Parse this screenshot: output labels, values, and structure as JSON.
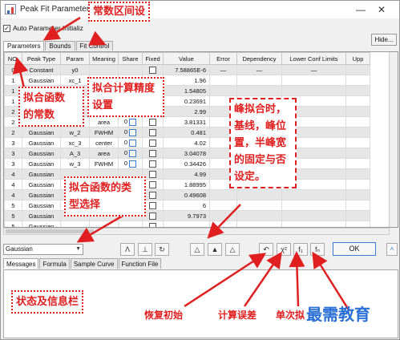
{
  "window": {
    "title": "Peak Fit Parameters"
  },
  "auto_param": {
    "label": "Auto Parameter Initializ"
  },
  "hide_button": "Hide...",
  "tabs": [
    {
      "label": "Parameters"
    },
    {
      "label": "Bounds"
    },
    {
      "label": "Fit Control"
    }
  ],
  "columns": [
    "NO.",
    "Peak Type",
    "Param",
    "Meaning",
    "Share",
    "Fixed",
    "Value",
    "Error",
    "Dependency",
    "Lower Conf Limits",
    "Upp"
  ],
  "rows": [
    {
      "no": "0",
      "type": "Constant",
      "param": "y0",
      "meaning": "",
      "share": "",
      "value": "7.58865E-6",
      "error": "—",
      "dep": "—",
      "lcl": "—"
    },
    {
      "no": "1",
      "type": "Gaussian",
      "param": "xc_1",
      "meaning": "",
      "share": "",
      "value": "1.96",
      "error": "",
      "dep": "",
      "lcl": ""
    },
    {
      "no": "1",
      "type": "Gaussian",
      "param": "A_1",
      "meaning": "",
      "share": "",
      "value": "1.54805",
      "error": "",
      "dep": "",
      "lcl": ""
    },
    {
      "no": "1",
      "type": "Gaussian",
      "param": "w_1",
      "meaning": "",
      "share": "",
      "value": "0.23691",
      "error": "",
      "dep": "",
      "lcl": ""
    },
    {
      "no": "2",
      "type": "Gaussian",
      "param": "xc_2",
      "meaning": "",
      "share": "",
      "value": "2.99",
      "error": "",
      "dep": "",
      "lcl": ""
    },
    {
      "no": "2",
      "type": "Gaussian",
      "param": "A_2",
      "meaning": "area",
      "share": "0",
      "value": "3.81331",
      "error": "",
      "dep": "",
      "lcl": ""
    },
    {
      "no": "2",
      "type": "Gaussian",
      "param": "w_2",
      "meaning": "FWHM",
      "share": "0",
      "value": "0.481",
      "error": "",
      "dep": "",
      "lcl": ""
    },
    {
      "no": "3",
      "type": "Gaussian",
      "param": "xc_3",
      "meaning": "center",
      "share": "0",
      "value": "4.02",
      "error": "",
      "dep": "",
      "lcl": ""
    },
    {
      "no": "3",
      "type": "Gaussian",
      "param": "A_3",
      "meaning": "area",
      "share": "0",
      "value": "3.04078",
      "error": "",
      "dep": "",
      "lcl": ""
    },
    {
      "no": "3",
      "type": "Gaussian",
      "param": "w_3",
      "meaning": "FWHM",
      "share": "0",
      "value": "0.34426",
      "error": "",
      "dep": "",
      "lcl": ""
    },
    {
      "no": "4",
      "type": "Gaussian",
      "param": "",
      "meaning": "",
      "share": "",
      "value": "4.99",
      "error": "",
      "dep": "",
      "lcl": ""
    },
    {
      "no": "4",
      "type": "Gaussian",
      "param": "",
      "meaning": "",
      "share": "",
      "value": "1.88995",
      "error": "",
      "dep": "",
      "lcl": ""
    },
    {
      "no": "4",
      "type": "Gaussian",
      "param": "",
      "meaning": "",
      "share": "",
      "value": "0.49608",
      "error": "",
      "dep": "",
      "lcl": ""
    },
    {
      "no": "5",
      "type": "Gaussian",
      "param": "",
      "meaning": "",
      "share": "",
      "value": "6",
      "error": "",
      "dep": "",
      "lcl": ""
    },
    {
      "no": "5",
      "type": "Gaussian",
      "param": "",
      "meaning": "",
      "share": "",
      "value": "9.7973",
      "error": "",
      "dep": "",
      "lcl": ""
    },
    {
      "no": "5",
      "type": "Gaussian",
      "param": "",
      "meaning": "",
      "share": "",
      "value": "",
      "error": "",
      "dep": "",
      "lcl": ""
    }
  ],
  "function_select": {
    "value": "Gaussian"
  },
  "ok_button": "OK",
  "bottom_tabs": [
    {
      "label": "Messages"
    },
    {
      "label": "Formula"
    },
    {
      "label": "Sample Curve"
    },
    {
      "label": "Function File"
    }
  ],
  "annotations": {
    "constant_interval": "常数区间设",
    "fit_constants": [
      "拟合函数",
      "的常数"
    ],
    "fit_precision": [
      "拟合计算精度",
      "设置"
    ],
    "peak_fix": [
      "峰拟合时，",
      "基线，峰位",
      "置，半峰宽",
      "的固定与否",
      "设定。"
    ],
    "function_type": [
      "拟合函数的类",
      "型选择"
    ],
    "status_bar": "状态及信息栏",
    "restore_init": "恢复初始",
    "calc_error": "计算误差",
    "single_iter": "单次拟",
    "watermark": "最需教育"
  },
  "icons": {
    "restore": "restore-init-icon",
    "chi_square": "chi-square-icon",
    "single_iteration": "single-iteration-icon",
    "multi_iteration": "multi-iteration-icon"
  },
  "colors": {
    "annotation": "#e02020",
    "watermark": "#2a6fd6",
    "accent": "#3a7bd5"
  }
}
